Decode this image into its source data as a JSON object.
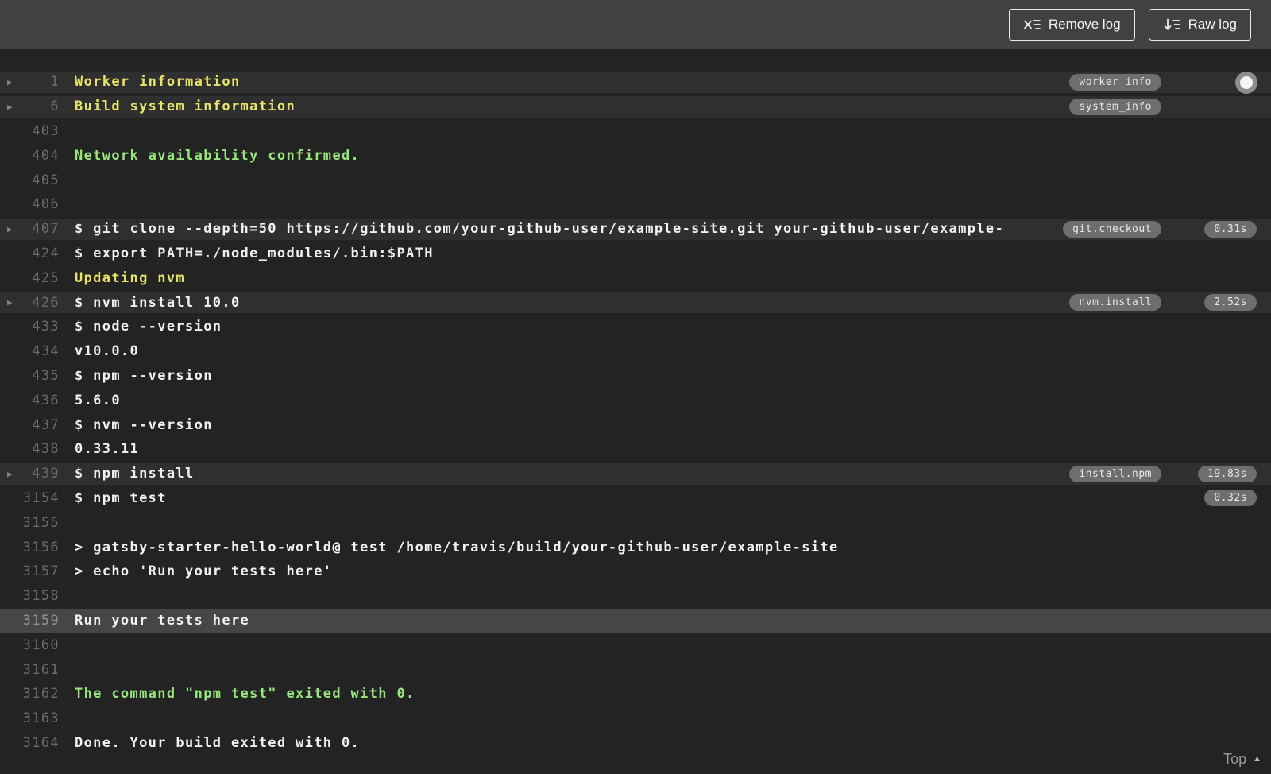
{
  "toolbar": {
    "remove_log_label": "Remove log",
    "raw_log_label": "Raw log"
  },
  "colors": {
    "toolbar_bg": "#424042",
    "log_bg": "#232323",
    "fold_row_bg": "#2f2f2f",
    "selected_row_bg": "#464646",
    "log_yellow": "#e8e36b",
    "log_green": "#99e57e",
    "log_text": "#f1f1f1",
    "pill_bg": "#6e6e6e"
  },
  "log": {
    "top_link_label": "Top",
    "rows": [
      {
        "line": "1",
        "text": "Worker information",
        "style": "yellow",
        "arrow": true,
        "fold": true,
        "tag": "worker_info"
      },
      {
        "line": "6",
        "text": "Build system information",
        "style": "yellow",
        "arrow": true,
        "fold": true,
        "tag": "system_info"
      },
      {
        "line": "403",
        "text": ""
      },
      {
        "line": "404",
        "text": "Network availability confirmed.",
        "style": "green"
      },
      {
        "line": "405",
        "text": ""
      },
      {
        "line": "406",
        "text": ""
      },
      {
        "line": "407",
        "text": "$ git clone --depth=50 https://github.com/your-github-user/example-site.git your-github-user/example-",
        "arrow": true,
        "fold": true,
        "tag": "git.checkout",
        "time": "0.31s"
      },
      {
        "line": "424",
        "text": "$ export PATH=./node_modules/.bin:$PATH"
      },
      {
        "line": "425",
        "text": "Updating nvm",
        "style": "yellow"
      },
      {
        "line": "426",
        "text": "$ nvm install 10.0",
        "arrow": true,
        "fold": true,
        "tag": "nvm.install",
        "time": "2.52s"
      },
      {
        "line": "433",
        "text": "$ node --version"
      },
      {
        "line": "434",
        "text": "v10.0.0"
      },
      {
        "line": "435",
        "text": "$ npm --version"
      },
      {
        "line": "436",
        "text": "5.6.0"
      },
      {
        "line": "437",
        "text": "$ nvm --version"
      },
      {
        "line": "438",
        "text": "0.33.11"
      },
      {
        "line": "439",
        "text": "$ npm install",
        "arrow": true,
        "fold": true,
        "tag": "install.npm",
        "time": "19.83s"
      },
      {
        "line": "3154",
        "text": "$ npm test",
        "time": "0.32s"
      },
      {
        "line": "3155",
        "text": ""
      },
      {
        "line": "3156",
        "text": "> gatsby-starter-hello-world@ test /home/travis/build/your-github-user/example-site"
      },
      {
        "line": "3157",
        "text": "> echo 'Run your tests here'"
      },
      {
        "line": "3158",
        "text": ""
      },
      {
        "line": "3159",
        "text": "Run your tests here",
        "selected": true
      },
      {
        "line": "3160",
        "text": ""
      },
      {
        "line": "3161",
        "text": ""
      },
      {
        "line": "3162",
        "text": "The command \"npm test\" exited with 0.",
        "style": "green"
      },
      {
        "line": "3163",
        "text": ""
      },
      {
        "line": "3164",
        "text": "Done. Your build exited with 0."
      }
    ]
  }
}
